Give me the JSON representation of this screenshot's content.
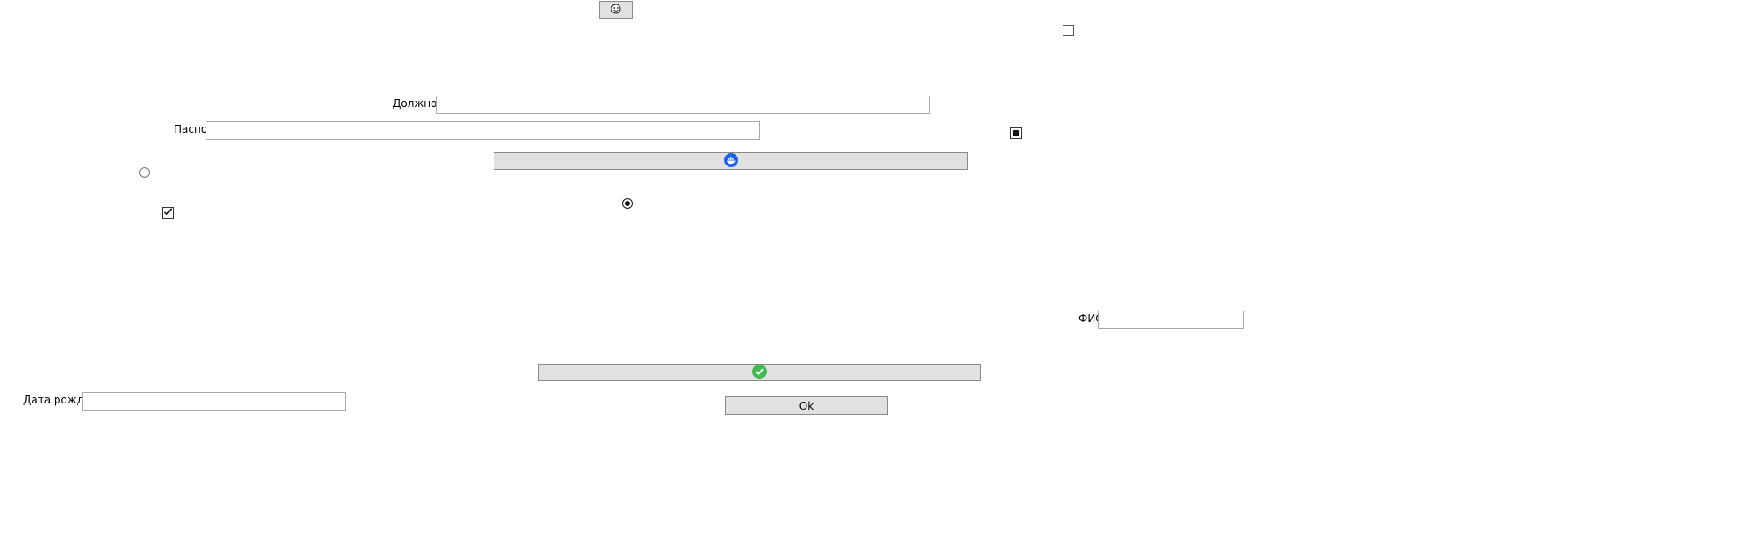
{
  "top_button": {
    "icon": "smiley-face-icon"
  },
  "fields": {
    "position": {
      "label": "Должность",
      "value": ""
    },
    "passport": {
      "label": "Паспорт",
      "value": ""
    },
    "full_name": {
      "label": "ФИО",
      "value": ""
    },
    "birth_date": {
      "label": "Дата рождения",
      "value": ""
    }
  },
  "checkboxes": {
    "top_right": {
      "checked": false
    },
    "middle_right": {
      "state": "indeterminate"
    },
    "left": {
      "checked": true
    }
  },
  "radios": {
    "left": {
      "checked": false
    },
    "center": {
      "checked": true
    }
  },
  "buttons": {
    "docker": {
      "icon": "docker-whale-icon"
    },
    "confirm": {
      "icon": "green-checkmark-icon"
    },
    "ok": {
      "label": "Ok"
    }
  },
  "colors": {
    "docker_blue": "#1d63ed",
    "check_green": "#3fb950",
    "button_face": "#e1e1e1"
  }
}
